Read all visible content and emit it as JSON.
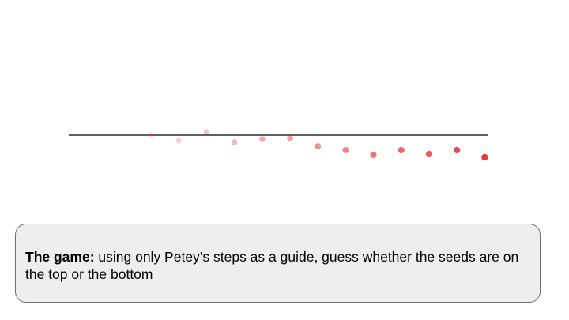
{
  "game": {
    "label": "The game:",
    "text": " using only Petey’s steps as a guide, guess whether the seeds are on the top or the bottom"
  },
  "board": {
    "dot_color": "#e8383c",
    "line_color": "#000000",
    "steps": [
      {
        "step": 1,
        "offset": 0.0,
        "opacity": 0.18
      },
      {
        "step": 2,
        "offset": -7,
        "opacity": 0.24
      },
      {
        "step": 3,
        "offset": 4,
        "opacity": 0.3
      },
      {
        "step": 4,
        "offset": -9,
        "opacity": 0.36
      },
      {
        "step": 5,
        "offset": -5,
        "opacity": 0.42
      },
      {
        "step": 6,
        "offset": -4,
        "opacity": 0.48
      },
      {
        "step": 7,
        "offset": -14,
        "opacity": 0.55
      },
      {
        "step": 8,
        "offset": -19,
        "opacity": 0.62
      },
      {
        "step": 9,
        "offset": -25,
        "opacity": 0.7
      },
      {
        "step": 10,
        "offset": -19,
        "opacity": 0.77
      },
      {
        "step": 11,
        "offset": -24,
        "opacity": 0.84
      },
      {
        "step": 12,
        "offset": -19,
        "opacity": 0.91
      },
      {
        "step": 13,
        "offset": -28,
        "opacity": 1.0
      }
    ]
  }
}
